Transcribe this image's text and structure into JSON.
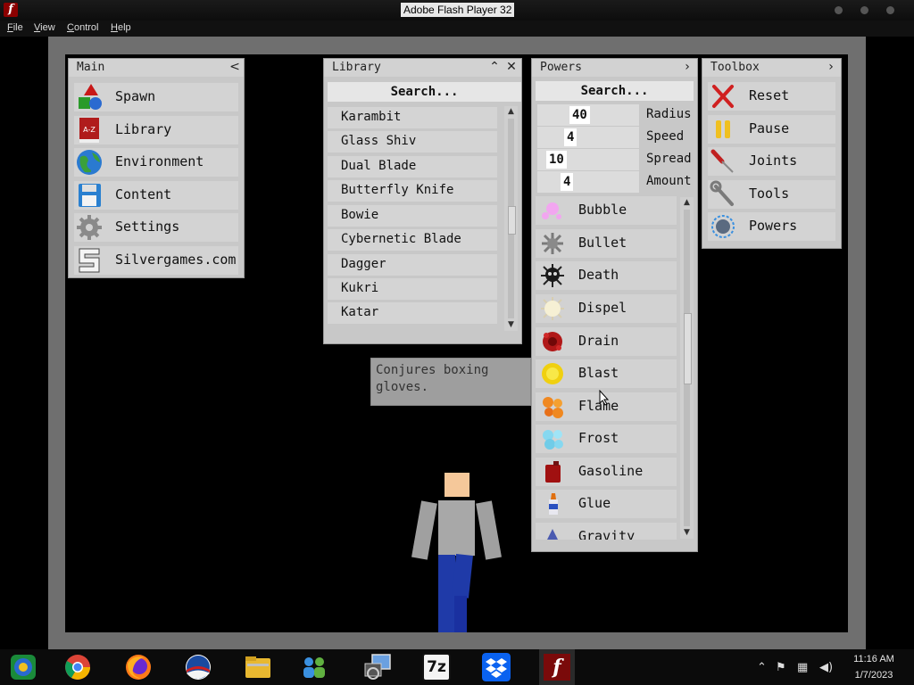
{
  "window": {
    "title": "Adobe Flash Player 32",
    "app_icon": "f"
  },
  "menubar": [
    "File",
    "View",
    "Control",
    "Help"
  ],
  "main_panel": {
    "title": "Main",
    "collapse_icon": "<",
    "items": [
      {
        "label": "Spawn",
        "icon": "shapes-icon"
      },
      {
        "label": "Library",
        "icon": "book-icon"
      },
      {
        "label": "Environment",
        "icon": "globe-icon"
      },
      {
        "label": "Content",
        "icon": "floppy-icon"
      },
      {
        "label": "Settings",
        "icon": "gear-icon"
      },
      {
        "label": "Silvergames.com",
        "icon": "silvergames-logo-icon"
      }
    ]
  },
  "library_panel": {
    "title": "Library",
    "search_placeholder": "Search...",
    "items": [
      "Karambit",
      "Glass Shiv",
      "Dual Blade",
      "Butterfly Knife",
      "Bowie",
      "Cybernetic Blade",
      "Dagger",
      "Kukri",
      "Katar"
    ]
  },
  "powers_panel": {
    "title": "Powers",
    "search_placeholder": "Search...",
    "params": [
      {
        "label": "Radius",
        "value": "40"
      },
      {
        "label": "Speed",
        "value": "4"
      },
      {
        "label": "Spread",
        "value": "10"
      },
      {
        "label": "Amount",
        "value": "4"
      }
    ],
    "items": [
      {
        "label": "Bubble",
        "color": "#f0a0f0"
      },
      {
        "label": "Bullet",
        "color": "#8a8a8a"
      },
      {
        "label": "Death",
        "color": "#222222"
      },
      {
        "label": "Dispel",
        "color": "#f4efd0"
      },
      {
        "label": "Drain",
        "color": "#b01818"
      },
      {
        "label": "Blast",
        "color": "#f0d010"
      },
      {
        "label": "Flame",
        "color": "#f08820"
      },
      {
        "label": "Frost",
        "color": "#80d8f0"
      },
      {
        "label": "Gasoline",
        "color": "#a01010"
      },
      {
        "label": "Glue",
        "color": "#e8e8f0"
      },
      {
        "label": "Gravity",
        "color": "#3040a0"
      }
    ]
  },
  "toolbox_panel": {
    "title": "Toolbox",
    "items": [
      {
        "label": "Reset",
        "icon": "x-icon"
      },
      {
        "label": "Pause",
        "icon": "pause-icon"
      },
      {
        "label": "Joints",
        "icon": "screwdriver-icon"
      },
      {
        "label": "Tools",
        "icon": "wrench-icon"
      },
      {
        "label": "Powers",
        "icon": "orb-icon"
      }
    ]
  },
  "tooltip": "Conjures boxing gloves.",
  "taskbar": {
    "apps": [
      "app-store-icon",
      "chrome-icon",
      "firefox-icon",
      "obama-logo-icon",
      "file-explorer-icon",
      "network-people-icon",
      "remote-desktop-icon",
      "7zip-icon",
      "dropbox-icon",
      "flash-icon"
    ],
    "label_7z": "7z",
    "label_flash": "f",
    "clock_time": "11:16 AM",
    "clock_date": "1/7/2023"
  }
}
